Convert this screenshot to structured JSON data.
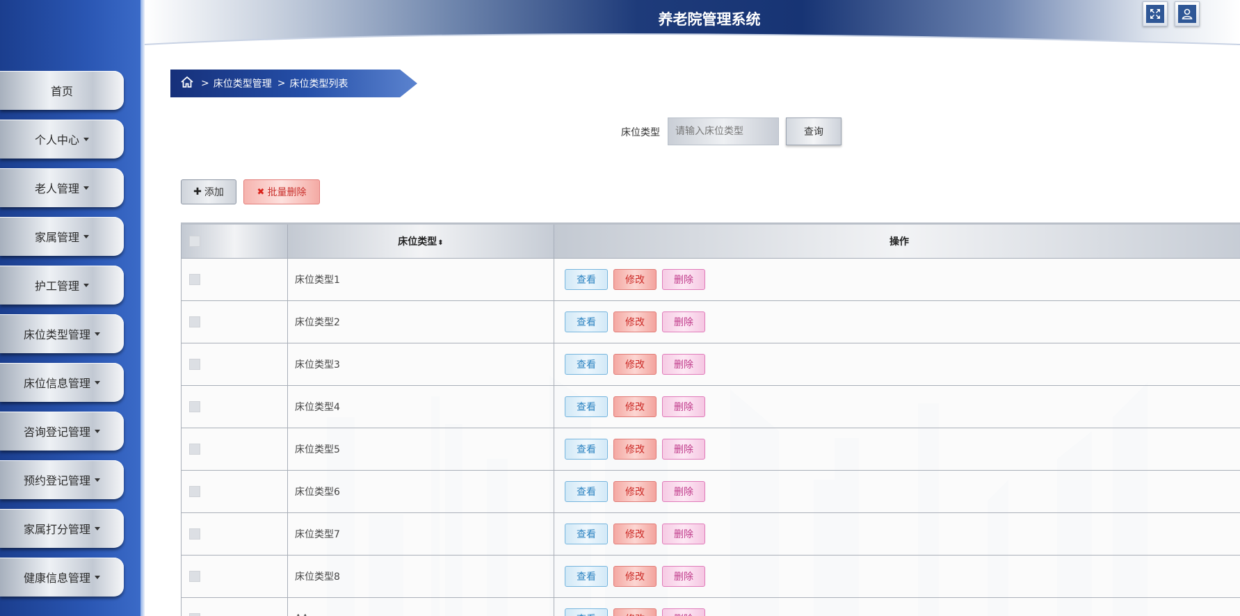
{
  "app": {
    "title": "养老院管理系统"
  },
  "header": {
    "icons": [
      "fullscreen-icon",
      "user-icon"
    ]
  },
  "sidebar": {
    "items": [
      {
        "label": "首页",
        "has_caret": false
      },
      {
        "label": "个人中心",
        "has_caret": true
      },
      {
        "label": "老人管理",
        "has_caret": true
      },
      {
        "label": "家属管理",
        "has_caret": true
      },
      {
        "label": "护工管理",
        "has_caret": true
      },
      {
        "label": "床位类型管理",
        "has_caret": true
      },
      {
        "label": "床位信息管理",
        "has_caret": true
      },
      {
        "label": "咨询登记管理",
        "has_caret": true
      },
      {
        "label": "预约登记管理",
        "has_caret": true
      },
      {
        "label": "家属打分管理",
        "has_caret": true
      },
      {
        "label": "健康信息管理",
        "has_caret": true
      }
    ]
  },
  "breadcrumb": {
    "sep": ">",
    "items": [
      "床位类型管理",
      "床位类型列表"
    ]
  },
  "search": {
    "label": "床位类型",
    "placeholder": "请输入床位类型",
    "value": "",
    "button": "查询"
  },
  "actions": {
    "add": "添加",
    "bulk_delete": "批量删除"
  },
  "table": {
    "columns": {
      "name": "床位类型",
      "ops": "操作"
    },
    "rows": [
      "床位类型1",
      "床位类型2",
      "床位类型3",
      "床位类型4",
      "床位类型5",
      "床位类型6",
      "床位类型7",
      "床位类型8",
      "AA"
    ],
    "row_actions": {
      "view": "查看",
      "edit": "修改",
      "delete": "删除"
    }
  }
}
